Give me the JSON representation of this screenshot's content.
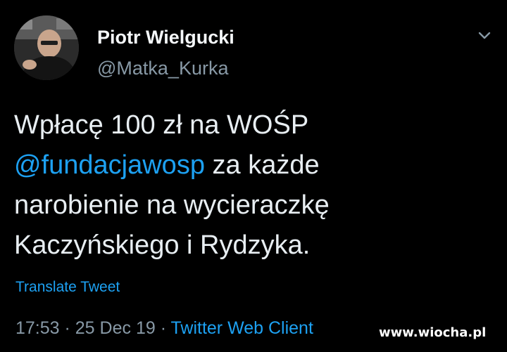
{
  "author": {
    "display_name": "Piotr Wielgucki",
    "handle": "@Matka_Kurka"
  },
  "tweet": {
    "line1": "Wpłacę 100 zł na WOŚP",
    "mention": "@fundacjawosp",
    "line2_rest": " za każde",
    "line3": "narobienie na wycieraczkę",
    "line4": "Kaczyńskiego i Rydzyka."
  },
  "translate_label": "Translate Tweet",
  "meta": {
    "time": "17:53",
    "separator1": " · ",
    "date": "25 Dec 19",
    "separator2": " · ",
    "source": "Twitter Web Client"
  },
  "watermark": "www.wiocha.pl",
  "icons": {
    "menu": "chevron-down-icon"
  },
  "colors": {
    "background": "#000000",
    "text": "#e8eef2",
    "secondary_text": "#8899a6",
    "link": "#1da1f2"
  }
}
